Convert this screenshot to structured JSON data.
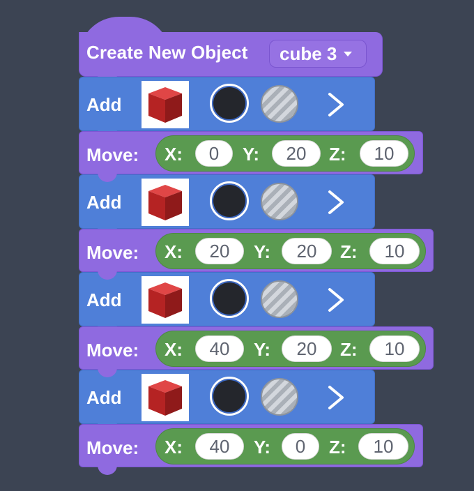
{
  "header": {
    "title": "Create New Object",
    "dropdown_value": "cube 3"
  },
  "add_label": "Add",
  "move_label": "Move:",
  "axis_labels": {
    "x": "X:",
    "y": "Y:",
    "z": "Z:"
  },
  "moves": [
    {
      "x": "0",
      "y": "20",
      "z": "10"
    },
    {
      "x": "20",
      "y": "20",
      "z": "10"
    },
    {
      "x": "40",
      "y": "20",
      "z": "10"
    },
    {
      "x": "40",
      "y": "0",
      "z": "10"
    }
  ],
  "colors": {
    "background": "#3c4453",
    "hat_block": "#8f6ae0",
    "add_block": "#4f7fd8",
    "coord_pill": "#5a9a50",
    "cube": "#c72a2a"
  },
  "icons": {
    "thumbnail": "red-cube-icon",
    "color_swatch": "black-color-swatch",
    "texture_swatch": "hatched-texture-swatch",
    "expand": "chevron-right-icon"
  }
}
